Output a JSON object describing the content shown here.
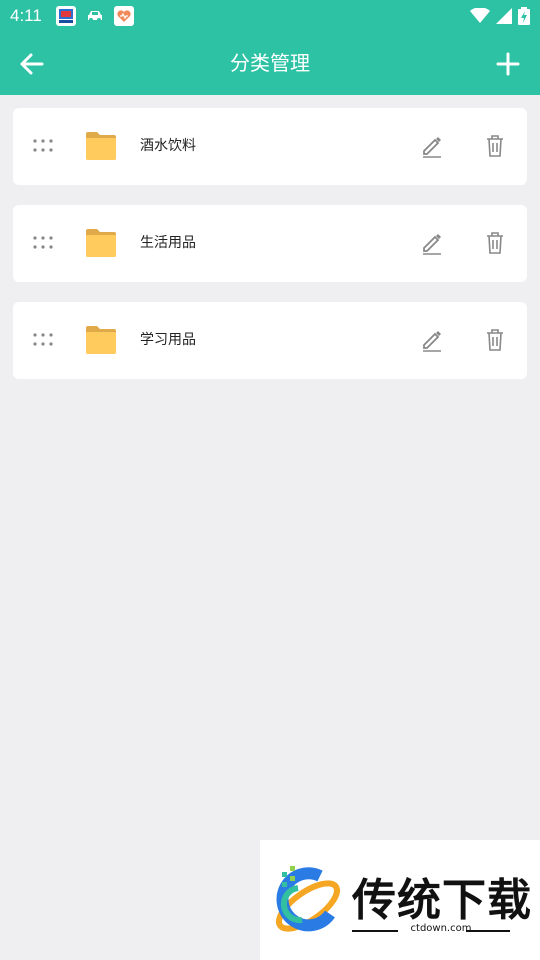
{
  "status_bar": {
    "time": "4:11",
    "icons": [
      "notification-app-icon",
      "car-app-icon",
      "heart-app-icon",
      "wifi-icon",
      "signal-icon",
      "battery-charging-icon"
    ]
  },
  "app_bar": {
    "title": "分类管理",
    "back_icon": "arrow-left-icon",
    "add_icon": "plus-icon",
    "color": "#2ec2a5"
  },
  "categories": [
    {
      "name": "酒水饮料"
    },
    {
      "name": "生活用品"
    },
    {
      "name": "学习用品"
    }
  ],
  "watermark": {
    "title": "传统下载",
    "url": "ctdown.com"
  }
}
